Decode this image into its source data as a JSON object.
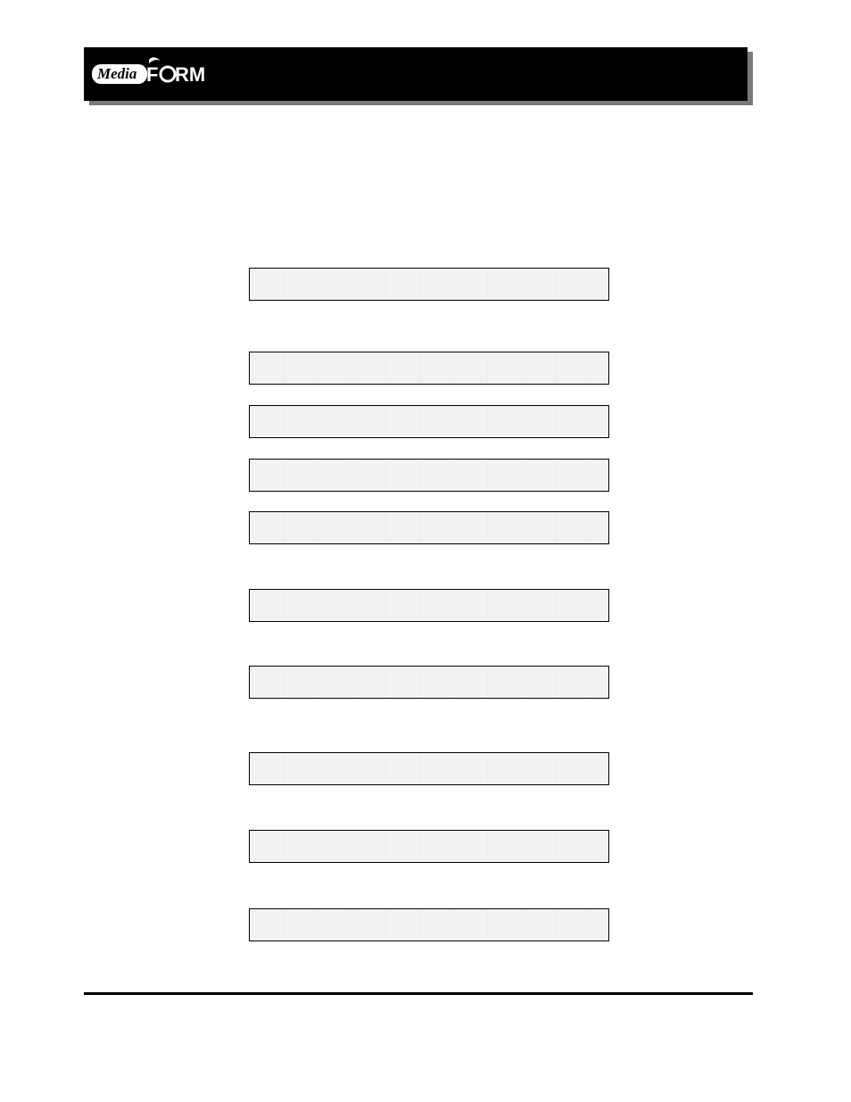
{
  "logo": {
    "text": "MediaFORM"
  },
  "lcds": {
    "row1": {
      "text": ""
    },
    "row2": {
      "text": ""
    },
    "row3": {
      "text": ""
    },
    "row4": {
      "text": ""
    },
    "row5": {
      "text": ""
    },
    "row6": {
      "text": ""
    },
    "row7": {
      "text": ""
    },
    "row8": {
      "text": ""
    },
    "row9": {
      "text": ""
    },
    "row10": {
      "text": ""
    }
  }
}
